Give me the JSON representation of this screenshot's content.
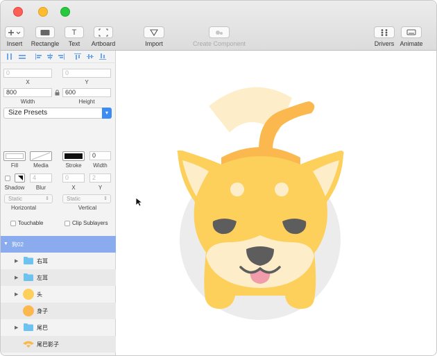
{
  "toolbar": {
    "insert": "Insert",
    "rectangle": "Rectangle",
    "text": "Text",
    "artboard": "Artboard",
    "import": "Import",
    "create_component": "Create Component",
    "drivers": "Drivers",
    "animate": "Animate",
    "text_icon_glyph": "T"
  },
  "inspector": {
    "x_value": "0",
    "x_label": "X",
    "y_value": "0",
    "y_label": "Y",
    "width_value": "800",
    "width_label": "Width",
    "height_value": "600",
    "height_label": "Height",
    "size_presets": "Size Presets",
    "fill_label": "Fill",
    "media_label": "Media",
    "stroke_label": "Stroke",
    "stroke_width_value": "0",
    "stroke_width_label": "Width",
    "shadow_label": "Shadow",
    "blur_value": "4",
    "blur_label": "Blur",
    "shadow_x_value": "0",
    "shadow_x_label": "X",
    "shadow_y_value": "2",
    "shadow_y_label": "Y",
    "horizontal_value": "Static",
    "horizontal_label": "Horizontal",
    "vertical_value": "Static",
    "vertical_label": "Vertical",
    "touchable_label": "Touchable",
    "clip_label": "Clip Sublayers"
  },
  "layers": [
    {
      "name": "狗02",
      "type": "group-open",
      "selected": true
    },
    {
      "name": "右耳",
      "type": "folder"
    },
    {
      "name": "左耳",
      "type": "folder"
    },
    {
      "name": "头",
      "type": "circle"
    },
    {
      "name": "身子",
      "type": "circle"
    },
    {
      "name": "尾巴",
      "type": "folder"
    },
    {
      "name": "尾巴影子",
      "type": "shape"
    }
  ],
  "colors": {
    "accent_blue": "#3b8cf5",
    "selection": "#8aabee",
    "folder_blue": "#6cc3f0",
    "dog_yellow": "#fdcf5b",
    "dog_orange": "#fbb84e",
    "dog_cream": "#fdeec9"
  }
}
